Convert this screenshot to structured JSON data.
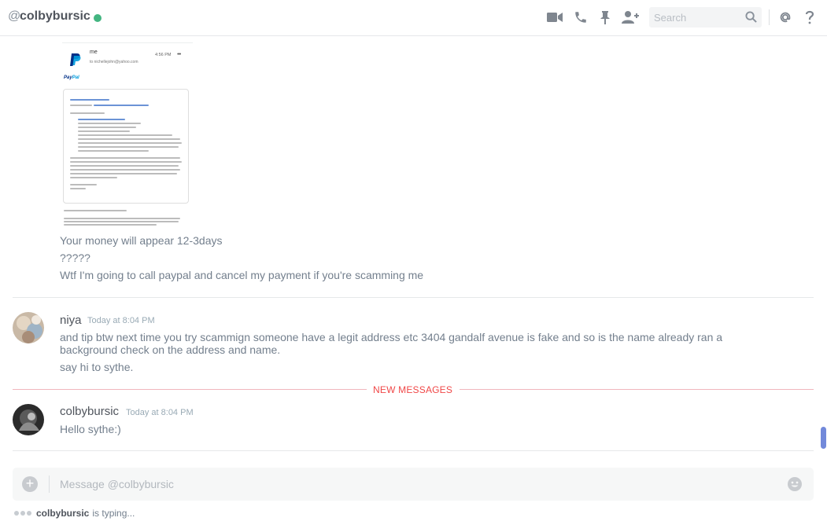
{
  "header": {
    "at_symbol": "@",
    "username": "colbybursic",
    "status_color": "#43b581",
    "icons": [
      "video-call-icon",
      "voice-call-icon",
      "pin-icon",
      "add-friend-icon",
      "search-icon",
      "mention-icon",
      "help-icon"
    ],
    "search_placeholder": "Search"
  },
  "attachment": {
    "from": "me",
    "to": "to nichellejohn@yahoo.com",
    "time": "4:56 PM",
    "brand": [
      "Pay",
      "Pal"
    ]
  },
  "messages_top": [
    "Your money will appear 12-3days",
    "?????",
    "Wtf I'm going to call paypal and cancel my payment if you're scamming me"
  ],
  "group_niya": {
    "author": "niya",
    "timestamp": "Today at 8:04 PM",
    "lines": [
      "and tip btw next time you try scammign someone have a legit address etc 3404 gandalf avenue is fake and so is the name already ran a",
      "background check on the address and name.",
      "say hi to sythe."
    ]
  },
  "divider": {
    "label": "NEW MESSAGES",
    "color": "#f04747"
  },
  "group_colby": {
    "author": "colbybursic",
    "timestamp": "Today at 8:04 PM",
    "lines": [
      "Hello sythe:)"
    ]
  },
  "composer": {
    "placeholder": "Message @colbybursic"
  },
  "typing": {
    "user": "colbybursic",
    "suffix": "is typing..."
  },
  "colors": {
    "accent": "#7289da",
    "text": "#737f8d",
    "author": "#4f545c"
  }
}
